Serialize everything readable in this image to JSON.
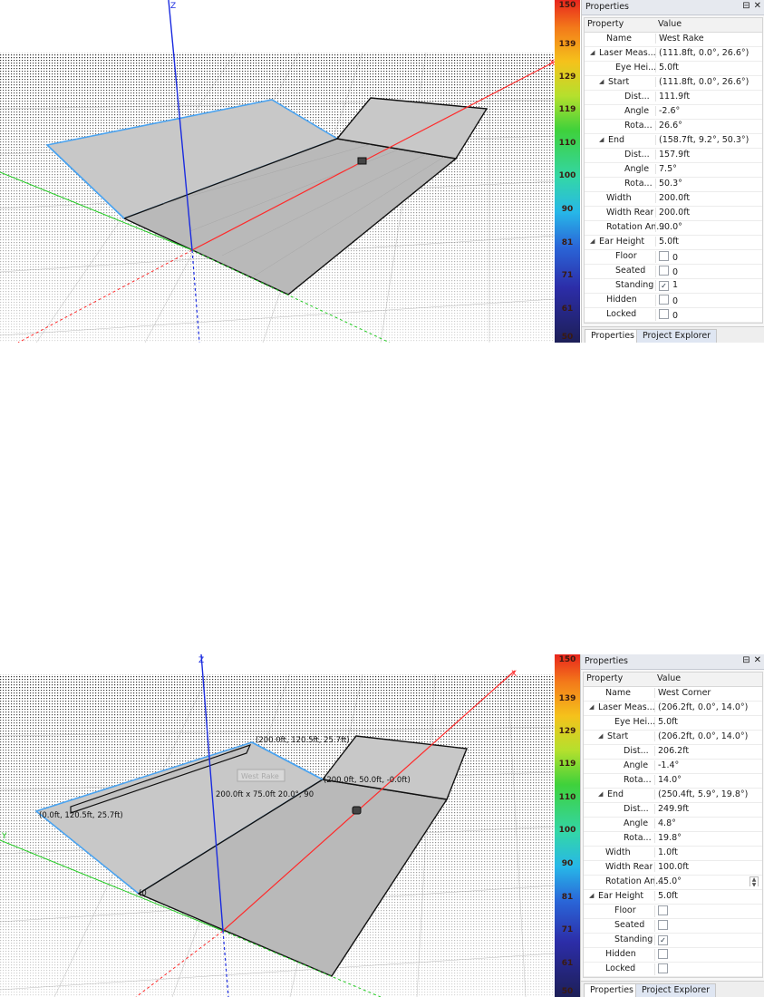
{
  "colorbar": {
    "ticks": [
      "150",
      "139",
      "129",
      "119",
      "110",
      "100",
      "90",
      "81",
      "71",
      "61",
      "50"
    ]
  },
  "screens": [
    {
      "viewport": {
        "axis_z_label": "Z",
        "axis_x_label": "X",
        "annotations": []
      },
      "panel": {
        "title": "Properties",
        "pin_icon": "pin-icon",
        "close_icon": "close-icon",
        "headers": {
          "property": "Property",
          "value": "Value"
        },
        "rows": [
          {
            "name": "Name",
            "value": "West Rake",
            "indent": 1
          },
          {
            "name": "Laser Meas...",
            "value": "(111.8ft, 0.0°, 26.6°)",
            "indent": 0,
            "expand": "◢"
          },
          {
            "name": "Eye Hei...",
            "value": "5.0ft",
            "indent": 2
          },
          {
            "name": "Start",
            "value": "(111.8ft, 0.0°, 26.6°)",
            "indent": 1,
            "expand": "◢"
          },
          {
            "name": "Dist...",
            "value": "111.9ft",
            "indent": 3
          },
          {
            "name": "Angle",
            "value": "-2.6°",
            "indent": 3
          },
          {
            "name": "Rota...",
            "value": "26.6°",
            "indent": 3
          },
          {
            "name": "End",
            "value": "(158.7ft, 9.2°, 50.3°)",
            "indent": 1,
            "expand": "◢"
          },
          {
            "name": "Dist...",
            "value": "157.9ft",
            "indent": 3
          },
          {
            "name": "Angle",
            "value": "7.5°",
            "indent": 3
          },
          {
            "name": "Rota...",
            "value": "50.3°",
            "indent": 3
          },
          {
            "name": "Width",
            "value": "200.0ft",
            "indent": 1
          },
          {
            "name": "Width Rear",
            "value": "200.0ft",
            "indent": 1
          },
          {
            "name": "Rotation An...",
            "value": "90.0°",
            "indent": 1
          },
          {
            "name": "Ear Height",
            "value": "5.0ft",
            "indent": 0,
            "expand": "◢"
          },
          {
            "name": "Floor",
            "value": "0",
            "indent": 2,
            "checkbox": true,
            "checked": false
          },
          {
            "name": "Seated",
            "value": "0",
            "indent": 2,
            "checkbox": true,
            "checked": false
          },
          {
            "name": "Standing",
            "value": "1",
            "indent": 2,
            "checkbox": true,
            "checked": true
          },
          {
            "name": "Hidden",
            "value": "0",
            "indent": 1,
            "checkbox": true,
            "checked": false
          },
          {
            "name": "Locked",
            "value": "0",
            "indent": 1,
            "checkbox": true,
            "checked": false
          }
        ],
        "tabs": [
          "Properties",
          "Project Explorer"
        ]
      }
    },
    {
      "viewport": {
        "axis_z_label": "Z",
        "axis_x_label": "X",
        "axis_y_label": "Y",
        "annotations": [
          "(200.0ft, 120.5ft, 25.7ft)",
          "(200.0ft, 50.0ft, -0.0ft)",
          "(0.0ft, 120.5ft, 25.7ft)",
          "200.0ft x 75.0ft 20.0°, 90",
          "West Rake",
          "(0"
        ]
      },
      "panel": {
        "title": "Properties",
        "pin_icon": "pin-icon",
        "close_icon": "close-icon",
        "headers": {
          "property": "Property",
          "value": "Value"
        },
        "rows": [
          {
            "name": "Name",
            "value": "West Corner",
            "indent": 1
          },
          {
            "name": "Laser Meas...",
            "value": "(206.2ft, 0.0°, 14.0°)",
            "indent": 0,
            "expand": "◢"
          },
          {
            "name": "Eye Hei...",
            "value": "5.0ft",
            "indent": 2
          },
          {
            "name": "Start",
            "value": "(206.2ft, 0.0°, 14.0°)",
            "indent": 1,
            "expand": "◢"
          },
          {
            "name": "Dist...",
            "value": "206.2ft",
            "indent": 3
          },
          {
            "name": "Angle",
            "value": "-1.4°",
            "indent": 3
          },
          {
            "name": "Rota...",
            "value": "14.0°",
            "indent": 3
          },
          {
            "name": "End",
            "value": "(250.4ft, 5.9°, 19.8°)",
            "indent": 1,
            "expand": "◢"
          },
          {
            "name": "Dist...",
            "value": "249.9ft",
            "indent": 3
          },
          {
            "name": "Angle",
            "value": "4.8°",
            "indent": 3
          },
          {
            "name": "Rota...",
            "value": "19.8°",
            "indent": 3
          },
          {
            "name": "Width",
            "value": "1.0ft",
            "indent": 1
          },
          {
            "name": "Width Rear",
            "value": "100.0ft",
            "indent": 1
          },
          {
            "name": "Rotation An...",
            "value": "45.0°",
            "indent": 1,
            "spin": true
          },
          {
            "name": "Ear Height",
            "value": "5.0ft",
            "indent": 0,
            "expand": "◢"
          },
          {
            "name": "Floor",
            "value": "",
            "indent": 2,
            "checkbox": true,
            "checked": false
          },
          {
            "name": "Seated",
            "value": "",
            "indent": 2,
            "checkbox": true,
            "checked": false
          },
          {
            "name": "Standing",
            "value": "",
            "indent": 2,
            "checkbox": true,
            "checked": true
          },
          {
            "name": "Hidden",
            "value": "",
            "indent": 1,
            "checkbox": true,
            "checked": false
          },
          {
            "name": "Locked",
            "value": "",
            "indent": 1,
            "checkbox": true,
            "checked": false
          }
        ],
        "tabs": [
          "Properties",
          "Project Explorer"
        ]
      }
    }
  ],
  "colors": {
    "plane_fill": "#c8c8c8",
    "plane_dark": "#b9b9b9",
    "selected_edge": "#4aa3f0",
    "x_axis": "#ff2a2a",
    "y_axis": "#22cc22",
    "z_axis": "#1a2be0",
    "edge": "#111111"
  }
}
